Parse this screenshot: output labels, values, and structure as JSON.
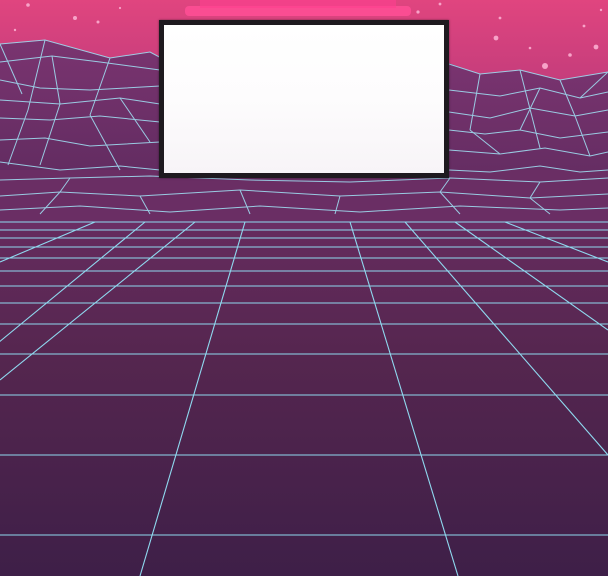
{
  "scene": {
    "colors": {
      "sky_top": "#e0457f",
      "sky_bottom": "#c23a78",
      "floor_top": "#6b2d63",
      "floor_bottom": "#3e1f48",
      "grid_line": "#8fd9ef",
      "mountain_fill": "#6a3166",
      "panel_border": "#1e1a1f",
      "panel_fill": "#ffffff",
      "sun_glow": "#ff3f8f",
      "stars": "#f7a3c8"
    },
    "screen_panel": {
      "text": ""
    }
  }
}
